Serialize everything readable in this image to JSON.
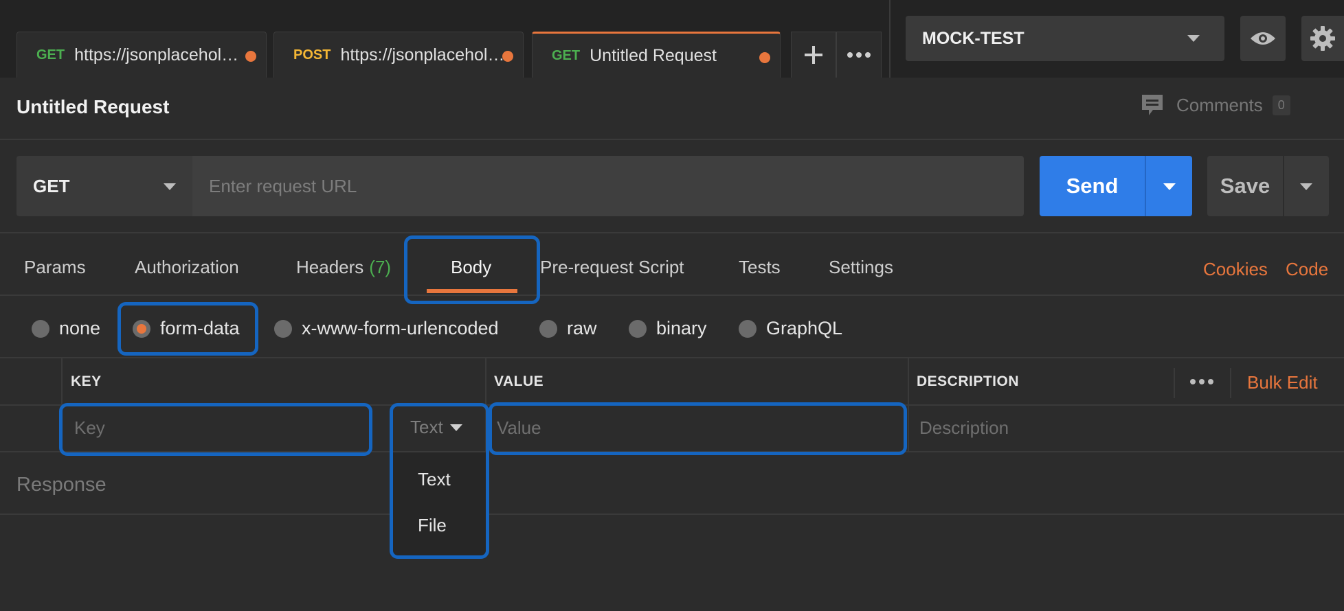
{
  "tabs": [
    {
      "method": "GET",
      "label": "https://jsonplaceholder.typicode.com/posts"
    },
    {
      "method": "POST",
      "label": "https://jsonplaceholder.typicode.com/posts"
    },
    {
      "method": "GET",
      "label": "Untitled Request"
    }
  ],
  "environment": {
    "selected": "MOCK-TEST"
  },
  "request": {
    "title": "Untitled Request",
    "comments_label": "Comments",
    "comments_count": "0",
    "method": "GET",
    "url_placeholder": "Enter request URL",
    "send_label": "Send",
    "save_label": "Save"
  },
  "request_tabs": {
    "params": "Params",
    "authorization": "Authorization",
    "headers": "Headers",
    "headers_count": "(7)",
    "body": "Body",
    "prerequest": "Pre-request Script",
    "tests": "Tests",
    "settings": "Settings",
    "cookies": "Cookies",
    "code": "Code"
  },
  "body_types": {
    "none": "none",
    "form_data": "form-data",
    "urlencoded": "x-www-form-urlencoded",
    "raw": "raw",
    "binary": "binary",
    "graphql": "GraphQL",
    "selected": "form-data"
  },
  "table": {
    "headers": {
      "key": "KEY",
      "value": "VALUE",
      "description": "DESCRIPTION"
    },
    "bulk_edit": "Bulk Edit",
    "row": {
      "key_placeholder": "Key",
      "type": "Text",
      "value_placeholder": "Value",
      "description_placeholder": "Description"
    },
    "type_options": [
      "Text",
      "File"
    ]
  },
  "response": {
    "label": "Response"
  },
  "colors": {
    "accent": "#e8763d",
    "send": "#2f7de8",
    "highlight": "#1565c0",
    "get": "#4caf50",
    "post": "#f5b735"
  }
}
